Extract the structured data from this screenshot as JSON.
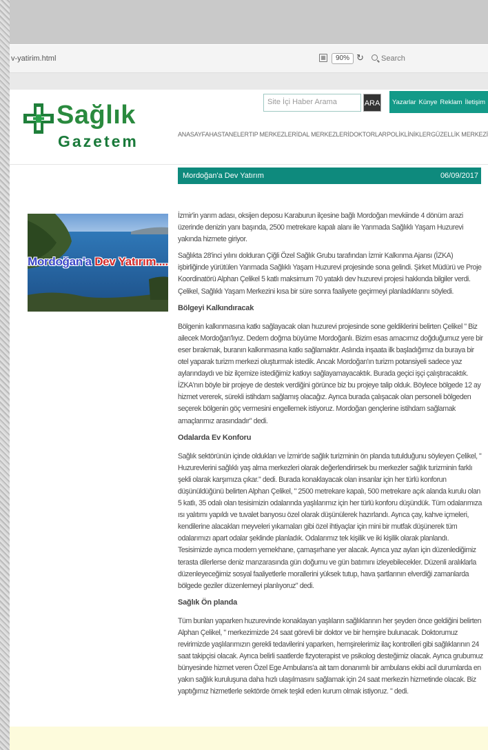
{
  "browser": {
    "url": "v-yatirim.html",
    "zoom": "90%",
    "search_placeholder": "Search"
  },
  "site": {
    "logo_top": "Sağlık",
    "logo_bottom": "Gazetem",
    "search_placeholder": "Site İçi Haber Arama",
    "search_button": "ARA",
    "quick_nav": [
      "Yazarlar",
      "Künye",
      "Reklam",
      "İletişim"
    ],
    "main_nav": [
      "ANASAYFA",
      "HASTANELER",
      "TIP MERKEZLERİ",
      "DAL MERKEZLERİ",
      "DOKTORLAR",
      "POLİKLİNİKLER",
      "GÜZELLİK MERKEZİ"
    ],
    "accent_color": "#0e8a7d"
  },
  "article": {
    "title": "Mordoğan'a Dev Yatırım",
    "date": "06/09/2017",
    "image_caption_part1": "Mordoğan'a",
    "image_caption_part2": "Dev Yatırım....",
    "p1": "İzmir'in yarım adası, oksijen deposu Karaburun ilçesine bağlı Mordoğan mevkiinde 4 dönüm arazi üzerinde denizin yanı başında, 2500 metrekare kapalı alanı ile Yarımada Sağlıklı Yaşam Huzurevi yakında hizmete giriyor.",
    "p2": "Sağlıkta 28'inci yılını dolduran Çiğli Özel Sağlık Grubu tarafından İzmir Kalkınma Ajansı (İZKA) işbirliğinde yürütülen Yarımada Sağlıklı Yaşam Huzurevi projesinde sona gelindi. Şirket Müdürü ve Proje Koordinatörü Alphan Çelikel 5 katlı maksimum 70 yataklı dev huzurevi projesi hakkında bilgiler verdi.  Çelikel, Sağlıklı Yaşam Merkezini kısa bir süre sonra faaliyete geçirmeyi planladıklarını söyledi.",
    "h1": "Bölgeyi Kalkındıracak",
    "p3": "Bölgenin kalkınmasına katkı sağlayacak olan huzurevi projesinde sone geldiklerini belirten Çelikel \" Biz ailecek Mordoğan'lıyız. Dedem doğma büyüme Mordoğanlı. Bizim esas amacımız doğduğumuz yere bir eser bırakmak, buranın kalkınmasına katkı sağlamaktır. Aslında inşaata ilk başladığımız da buraya bir otel yaparak turizm merkezi oluşturmak istedik. Ancak Mordoğan'ın turizm potansiyeli sadece yaz aylarındaydı ve biz ilçemize istediğimiz katkıyı sağlayamayacaktık. Burada geçici işçi çalıştıracaktık. İZKA'nın böyle bir projeye de destek verdiğini görünce biz bu projeye talip olduk. Böylece bölgede 12 ay hizmet vererek, sürekli istihdam sağlamış olacağız. Ayrıca burada çalışacak olan personeli bölgeden seçerek bölgenin göç vermesini engellemek istiyoruz. Mordoğan gençlerine istihdam sağlamak amaçlarımız arasındadır\" dedi.",
    "h2": "Odalarda Ev Konforu",
    "p4": "Sağlık sektörünün içinde oldukları ve İzmir'de sağlık turizminin ön planda tutulduğunu söyleyen Çelikel, \" Huzurevlerini sağlıklı yaş alma merkezleri olarak değerlendirirsek bu merkezler sağlık turizminin farklı şekli olarak karşımıza çıkar.\" dedi. Burada konaklayacak olan insanlar için her türlü konforun düşünüldüğünü belirten Alphan Çelikel, \" 2500 metrekare kapalı, 500 metrekare açık alanda kurulu olan 5 katlı, 35 odalı olan tesisimizin odalarında yaşlılarımız için her türlü konforu düşündük. Tüm odalarımıza ısı yalıtımı yapıldı ve tuvalet banyosu özel olarak düşünülerek hazırlandı. Ayrıca çay, kahve içmeleri, kendilerine alacakları meyveleri yıkamaları gibi özel ihtiyaçlar için mini bir mutfak düşünerek tüm odalarımızı apart odalar şeklinde planladık. Odalarımız tek kişilik ve iki kişilik olarak planlandı. Tesisimizde ayrıca modern yemekhane, çamaşırhane yer alacak. Ayrıca yaz ayları için düzenlediğimiz terasta dilerlerse deniz manzarasında gün doğumu ve gün batımını izleyebilecekler. Düzenli aralıklarla düzenleyeceğimiz sosyal faaliyetlerle morallerini yüksek tutup, hava şartlarının elverdiği zamanlarda bölgede geziler düzenlemeyi planlıyoruz\" dedi.",
    "h3": "Sağlık Ön planda",
    "p5": "Tüm bunları yaparken huzurevinde konaklayan yaşlıların sağlıklarının her şeyden önce geldiğini belirten Alphan Çelikel, \" merkezimizde 24 saat görevli bir doktor ve bir hemşire bulunacak. Doktorumuz revirimizde yaşlılarımızın gerekli tedavilerini yaparken, hemşirelerimiz ilaç kontrolleri gibi sağlıklarının 24 saat takipçisi olacak. Ayrıca belirli saatlerde fizyoterapist ve psikolog desteğimiz olacak. Ayrıca grubumuz bünyesinde hizmet veren Özel Ege Ambulans'a ait tam donanımlı bir ambulans ekibi acil durumlarda en yakın sağlık kuruluşuna daha hızlı ulaşılmasını sağlamak için 24 saat merkezin hizmetinde olacak. Biz yaptığımız hizmetlerle sektörde örnek teşkil eden kurum olmak istiyoruz. \" dedi."
  }
}
